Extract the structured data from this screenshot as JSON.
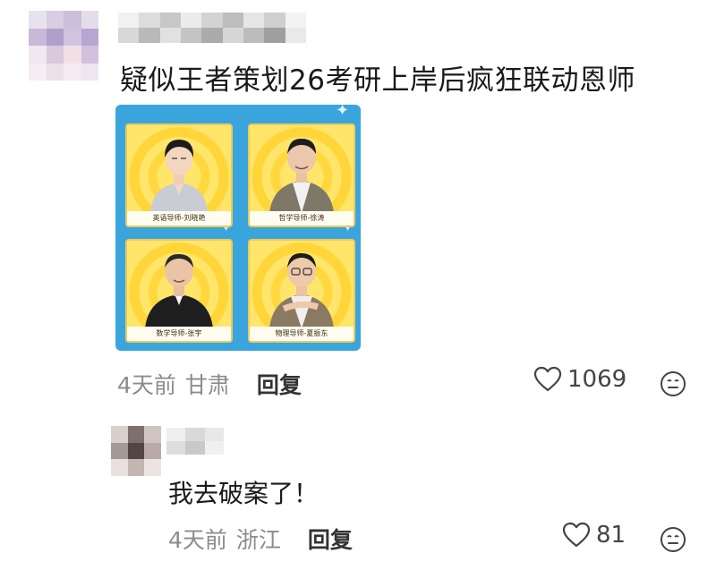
{
  "comment": {
    "text": "疑似王者策划26考研上岸后疯狂联动恩师",
    "time": "4天前",
    "location": "甘肃",
    "reply_label": "回复",
    "likes": "1069"
  },
  "image_card": {
    "tiles": [
      {
        "caption": "英语导师-刘晓艳"
      },
      {
        "caption": "哲学导师-徐涛"
      },
      {
        "caption": "数学导师-张宇"
      },
      {
        "caption": "物理导师-夏振东"
      }
    ]
  },
  "reply": {
    "text": "我去破案了！",
    "time": "4天前",
    "location": "浙江",
    "reply_label": "回复",
    "likes": "81"
  },
  "icons": {
    "like": "heart-outline-icon",
    "emoji": "neutral-face-icon"
  },
  "colors": {
    "card_bg": "#3aa5dd",
    "tile_yellow": "#ffe66b",
    "meta_gray": "#8c8c8c"
  }
}
